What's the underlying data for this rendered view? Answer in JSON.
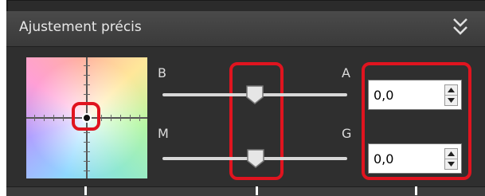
{
  "panel": {
    "title": "Ajustement précis"
  },
  "axes": {
    "b": "B",
    "a": "A",
    "m": "M",
    "g": "G"
  },
  "fields": {
    "ba_value": "0,0",
    "mg_value": "0,0"
  },
  "colors": {
    "highlight": "#e0141f",
    "panel_bg": "#2f2f2f",
    "header_bg": "#3f3f3f"
  }
}
